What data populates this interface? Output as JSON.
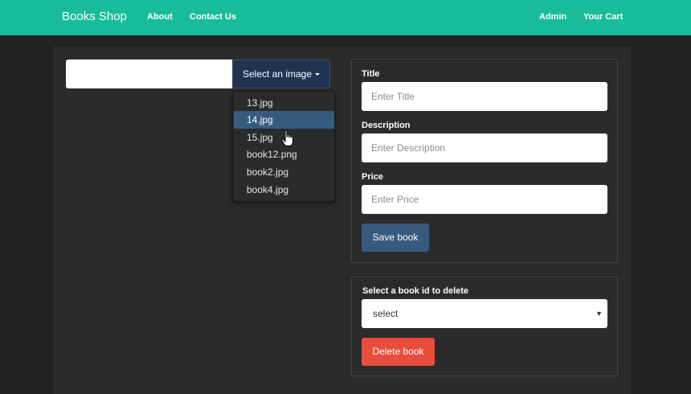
{
  "navbar": {
    "brand": "Books Shop",
    "links": [
      "About",
      "Contact Us"
    ],
    "right_links": [
      "Admin",
      "Your Cart"
    ],
    "color": "#18bc9c"
  },
  "image_picker": {
    "button_label": "Select an image",
    "options": [
      "13.jpg",
      "14.jpg",
      "15.jpg",
      "book12.png",
      "book2.jpg",
      "book4.jpg"
    ],
    "highlighted": "14.jpg"
  },
  "form": {
    "title_label": "Title",
    "title_placeholder": "Enter Title",
    "description_label": "Description",
    "description_placeholder": "Enter Description",
    "price_label": "Price",
    "price_placeholder": "Enter Price",
    "save_label": "Save book"
  },
  "delete": {
    "label": "Select a book id to delete",
    "selected": "select",
    "button_label": "Delete book"
  },
  "colors": {
    "primary": "#375a7f",
    "danger": "#e74c3c",
    "background": "#222222"
  }
}
